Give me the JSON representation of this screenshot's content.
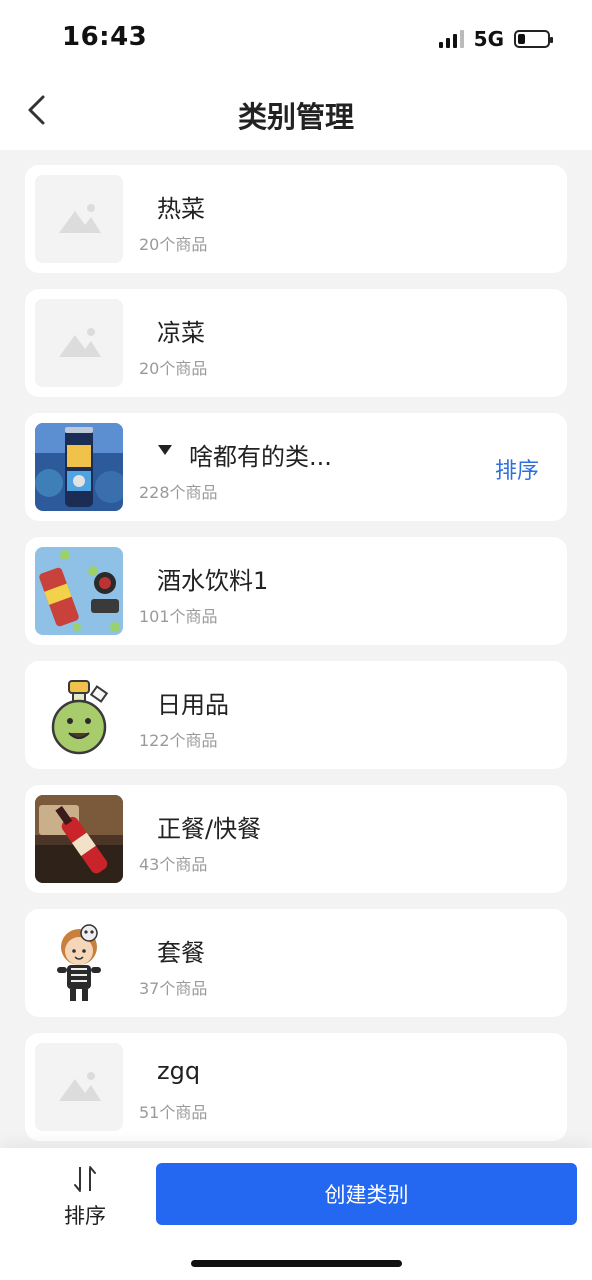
{
  "status": {
    "time": "16:43",
    "network": "5G"
  },
  "nav": {
    "title": "类别管理"
  },
  "categories": [
    {
      "name": "热菜",
      "count": "20个商品",
      "image": "placeholder"
    },
    {
      "name": "凉菜",
      "count": "20个商品",
      "image": "placeholder"
    },
    {
      "name": "啥都有的类...",
      "count": "228个商品",
      "image": "beer-can-art",
      "expanded": true,
      "sort_label": "排序"
    },
    {
      "name": "酒水饮料1",
      "count": "101个商品",
      "image": "drink-can-ad"
    },
    {
      "name": "日用品",
      "count": "122个商品",
      "image": "potion-character"
    },
    {
      "name": "正餐/快餐",
      "count": "43个商品",
      "image": "bottle-photo"
    },
    {
      "name": "套餐",
      "count": "37个商品",
      "image": "cartoon-boy"
    },
    {
      "name": "zgq",
      "count": "51个商品",
      "image": "placeholder"
    }
  ],
  "bottom": {
    "sort_label": "排序",
    "create_label": "创建类别"
  },
  "colors": {
    "accent": "#2468f2",
    "link": "#2f6fe0",
    "background": "#f3f3f3"
  }
}
